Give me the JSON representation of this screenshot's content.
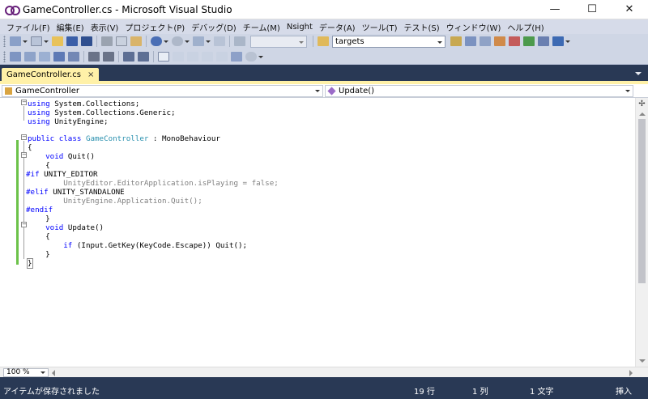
{
  "window": {
    "title": "GameController.cs - Microsoft Visual Studio",
    "minimize": "—",
    "maximize": "☐",
    "close": "✕"
  },
  "menu": [
    "ファイル(F)",
    "編集(E)",
    "表示(V)",
    "プロジェクト(P)",
    "デバッグ(D)",
    "チーム(M)",
    "Nsight",
    "データ(A)",
    "ツール(T)",
    "テスト(S)",
    "ウィンドウ(W)",
    "ヘルプ(H)"
  ],
  "toolbar": {
    "find_combo_value": "targets"
  },
  "tab": {
    "label": "GameController.cs",
    "close": "×"
  },
  "navbar": {
    "type_combo": "GameController",
    "member_combo": "Update()"
  },
  "code": {
    "lines": [
      "using System.Collections;",
      "using System.Collections.Generic;",
      "using UnityEngine;",
      "",
      "public class GameController : MonoBehaviour",
      "{",
      "    void Quit()",
      "    {",
      "#if UNITY_EDITOR",
      "        UnityEditor.EditorApplication.isPlaying = false;",
      "#elif UNITY_STANDALONE",
      "        UnityEngine.Application.Quit();",
      "#endif",
      "    }",
      "    void Update()",
      "    {",
      "        if (Input.GetKey(KeyCode.Escape)) Quit();",
      "    }",
      "}"
    ]
  },
  "editor": {
    "zoom": "100 %"
  },
  "status": {
    "message": "アイテムが保存されました",
    "line": "19 行",
    "column": "1 列",
    "char": "1 文字",
    "mode": "挿入"
  },
  "colors": {
    "keyword": "#0000ff",
    "type": "#2b91af",
    "inactive": "#808080",
    "chrome": "#293955",
    "active_tab": "#fff1a8",
    "change_marker": "#6cc24a"
  }
}
